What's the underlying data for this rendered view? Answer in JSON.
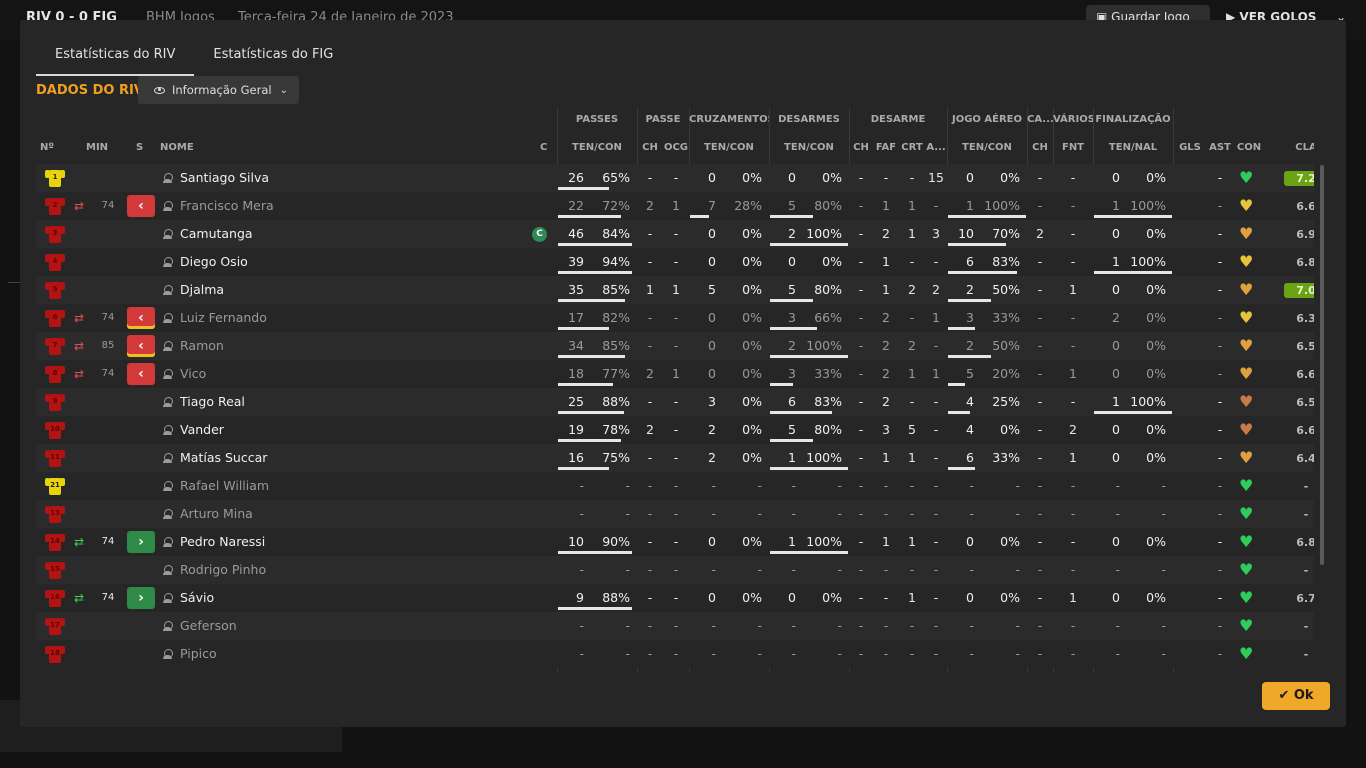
{
  "background": {
    "score": "RIV  0 - 0  FIG",
    "company": "BHM Jogos",
    "date": "Terça-feira 24 de Janeiro de 2023",
    "save_label": "Guardar Jogo",
    "goals_label": "VER GOLOS"
  },
  "tabs": [
    {
      "label": "Estatísticas do RIV",
      "active": true
    },
    {
      "label": "Estatísticas do FIG",
      "active": false
    }
  ],
  "section_title": "DADOS DO RIV",
  "view_dropdown": {
    "label": "Informação Geral"
  },
  "groups": {
    "passes": "PASSES",
    "passe": "PASSE",
    "cruzamentos": "CRUZAMENTOS",
    "desarmes": "DESARMES",
    "desarme": "DESARME",
    "jogo_aereo": "JOGO AÉREO",
    "ca": "CA...",
    "varios": "VÁRIOS",
    "finalizacao": "FINALIZAÇÃO"
  },
  "headers": {
    "no": "Nº",
    "min": "MIN",
    "s": "S",
    "nome": "NOME",
    "c": "C",
    "passes_tc": "TEN/CON",
    "passe_ch": "CH",
    "passe_ocg": "OCG",
    "cruz_tc": "TEN/CON",
    "des_tc": "TEN/CON",
    "desarme_ch": "CH",
    "desarme_faf": "FAF",
    "desarme_crt": "CRT",
    "desarme_a": "A...",
    "aereo_tc": "TEN/CON",
    "ca_ch": "CH",
    "varios_fnt": "FNT",
    "fin_tn": "TEN/NAL",
    "gls": "GLS",
    "ast": "AST",
    "con": "CON",
    "cla": "CLA"
  },
  "colors": {
    "accent": "#f0a020",
    "heart_green": "#2ecc5a",
    "heart_yellow": "#e8c43a",
    "heart_orange": "#e0a040",
    "heart_brown": "#c87a48",
    "rating_high": "#6aa313",
    "sub_out": "#d23a3a",
    "sub_in": "#2f8a48"
  },
  "players": [
    {
      "shirt": "gk",
      "number": "1",
      "name": "Santiago Silva",
      "on": true,
      "min": "",
      "sub": "",
      "captain": false,
      "p": [
        "26",
        "65%"
      ],
      "pb": 0.69,
      "pch": "-",
      "pocg": "-",
      "cr": [
        "0",
        "0%"
      ],
      "crb": 0,
      "de": [
        "0",
        "0%"
      ],
      "deb": 0,
      "dch": "-",
      "dfaf": "-",
      "dcrt": "-",
      "da": "15",
      "ja": [
        "0",
        "0%"
      ],
      "jab": 0,
      "cach": "-",
      "fnt": "-",
      "fi": [
        "0",
        "0%"
      ],
      "fib": 0,
      "gls": "",
      "ast": "-",
      "con": "green",
      "cla": "7.2",
      "hi": true
    },
    {
      "shirt": "out",
      "number": "2",
      "name": "Francisco Mera",
      "on": false,
      "min": "74",
      "sub": "out",
      "subYellow": false,
      "captain": false,
      "p": [
        "22",
        "72%"
      ],
      "pb": 0.85,
      "pch": "2",
      "pocg": "1",
      "cr": [
        "7",
        "28%"
      ],
      "crb": 0.25,
      "de": [
        "5",
        "80%"
      ],
      "deb": 0.55,
      "dch": "-",
      "dfaf": "1",
      "dcrt": "1",
      "da": "-",
      "ja": [
        "1",
        "100%"
      ],
      "jab": 1,
      "cach": "-",
      "fnt": "-",
      "fi": [
        "1",
        "100%"
      ],
      "fib": 1,
      "gls": "",
      "ast": "-",
      "con": "yellow",
      "cla": "6.6",
      "hi": false
    },
    {
      "shirt": "out",
      "number": "3",
      "name": "Camutanga",
      "on": true,
      "min": "",
      "sub": "",
      "captain": true,
      "p": [
        "46",
        "84%"
      ],
      "pb": 1,
      "pch": "-",
      "pocg": "-",
      "cr": [
        "0",
        "0%"
      ],
      "crb": 0,
      "de": [
        "2",
        "100%"
      ],
      "deb": 1,
      "dch": "-",
      "dfaf": "2",
      "dcrt": "1",
      "da": "3",
      "ja": [
        "10",
        "70%"
      ],
      "jab": 0.74,
      "cach": "2",
      "fnt": "-",
      "fi": [
        "0",
        "0%"
      ],
      "fib": 0,
      "gls": "",
      "ast": "-",
      "con": "orange",
      "cla": "6.9",
      "hi": false
    },
    {
      "shirt": "out",
      "number": "4",
      "name": "Diego Osio",
      "on": true,
      "min": "",
      "sub": "",
      "captain": false,
      "p": [
        "39",
        "94%"
      ],
      "pb": 1,
      "pch": "-",
      "pocg": "-",
      "cr": [
        "0",
        "0%"
      ],
      "crb": 0,
      "de": [
        "0",
        "0%"
      ],
      "deb": 0,
      "dch": "-",
      "dfaf": "1",
      "dcrt": "-",
      "da": "-",
      "ja": [
        "6",
        "83%"
      ],
      "jab": 0.88,
      "cach": "-",
      "fnt": "-",
      "fi": [
        "1",
        "100%"
      ],
      "fib": 1,
      "gls": "",
      "ast": "-",
      "con": "yellow",
      "cla": "6.8",
      "hi": false
    },
    {
      "shirt": "out",
      "number": "5",
      "name": "Djalma",
      "on": true,
      "min": "",
      "sub": "",
      "captain": false,
      "p": [
        "35",
        "85%"
      ],
      "pb": 0.9,
      "pch": "1",
      "pocg": "1",
      "cr": [
        "5",
        "0%"
      ],
      "crb": 0,
      "de": [
        "5",
        "80%"
      ],
      "deb": 0.55,
      "dch": "-",
      "dfaf": "1",
      "dcrt": "2",
      "da": "2",
      "ja": [
        "2",
        "50%"
      ],
      "jab": 0.55,
      "cach": "-",
      "fnt": "1",
      "fi": [
        "0",
        "0%"
      ],
      "fib": 0,
      "gls": "",
      "ast": "-",
      "con": "orange",
      "cla": "7.0",
      "hi": true
    },
    {
      "shirt": "out",
      "number": "6",
      "name": "Luiz Fernando",
      "on": false,
      "min": "74",
      "sub": "out",
      "subYellow": true,
      "captain": false,
      "p": [
        "17",
        "82%"
      ],
      "pb": 0.69,
      "pch": "-",
      "pocg": "-",
      "cr": [
        "0",
        "0%"
      ],
      "crb": 0,
      "de": [
        "3",
        "66%"
      ],
      "deb": 0.6,
      "dch": "-",
      "dfaf": "2",
      "dcrt": "-",
      "da": "1",
      "ja": [
        "3",
        "33%"
      ],
      "jab": 0.34,
      "cach": "-",
      "fnt": "-",
      "fi": [
        "2",
        "0%"
      ],
      "fib": 0,
      "gls": "",
      "ast": "-",
      "con": "yellow",
      "cla": "6.3",
      "hi": false
    },
    {
      "shirt": "out",
      "number": "7",
      "name": "Ramon",
      "on": false,
      "min": "85",
      "sub": "out",
      "subYellow": true,
      "captain": false,
      "p": [
        "34",
        "85%"
      ],
      "pb": 0.9,
      "pch": "-",
      "pocg": "-",
      "cr": [
        "0",
        "0%"
      ],
      "crb": 0,
      "de": [
        "2",
        "100%"
      ],
      "deb": 1,
      "dch": "-",
      "dfaf": "2",
      "dcrt": "2",
      "da": "-",
      "ja": [
        "2",
        "50%"
      ],
      "jab": 0.55,
      "cach": "-",
      "fnt": "-",
      "fi": [
        "0",
        "0%"
      ],
      "fib": 0,
      "gls": "",
      "ast": "-",
      "con": "orange",
      "cla": "6.5",
      "hi": false
    },
    {
      "shirt": "out",
      "number": "8",
      "name": "Vico",
      "on": false,
      "min": "74",
      "sub": "out",
      "subYellow": false,
      "captain": false,
      "p": [
        "18",
        "77%"
      ],
      "pb": 0.74,
      "pch": "2",
      "pocg": "1",
      "cr": [
        "0",
        "0%"
      ],
      "crb": 0,
      "de": [
        "3",
        "33%"
      ],
      "deb": 0.3,
      "dch": "-",
      "dfaf": "2",
      "dcrt": "1",
      "da": "1",
      "ja": [
        "5",
        "20%"
      ],
      "jab": 0.22,
      "cach": "-",
      "fnt": "1",
      "fi": [
        "0",
        "0%"
      ],
      "fib": 0,
      "gls": "",
      "ast": "-",
      "con": "orange",
      "cla": "6.6",
      "hi": false
    },
    {
      "shirt": "out",
      "number": "9",
      "name": "Tiago Real",
      "on": true,
      "min": "",
      "sub": "",
      "captain": false,
      "p": [
        "25",
        "88%"
      ],
      "pb": 0.89,
      "pch": "-",
      "pocg": "-",
      "cr": [
        "3",
        "0%"
      ],
      "crb": 0,
      "de": [
        "6",
        "83%"
      ],
      "deb": 0.8,
      "dch": "-",
      "dfaf": "2",
      "dcrt": "-",
      "da": "-",
      "ja": [
        "4",
        "25%"
      ],
      "jab": 0.28,
      "cach": "-",
      "fnt": "-",
      "fi": [
        "1",
        "100%"
      ],
      "fib": 1,
      "gls": "",
      "ast": "-",
      "con": "brown",
      "cla": "6.5",
      "hi": false
    },
    {
      "shirt": "out",
      "number": "10",
      "name": "Vander",
      "on": true,
      "min": "",
      "sub": "",
      "captain": false,
      "p": [
        "19",
        "78%"
      ],
      "pb": 0.85,
      "pch": "2",
      "pocg": "-",
      "cr": [
        "2",
        "0%"
      ],
      "crb": 0,
      "de": [
        "5",
        "80%"
      ],
      "deb": 0.55,
      "dch": "-",
      "dfaf": "3",
      "dcrt": "5",
      "da": "-",
      "ja": [
        "4",
        "0%"
      ],
      "jab": 0,
      "cach": "-",
      "fnt": "2",
      "fi": [
        "0",
        "0%"
      ],
      "fib": 0,
      "gls": "",
      "ast": "-",
      "con": "brown",
      "cla": "6.6",
      "hi": false
    },
    {
      "shirt": "out",
      "number": "11",
      "name": "Matías Succar",
      "on": true,
      "min": "",
      "sub": "",
      "captain": false,
      "p": [
        "16",
        "75%"
      ],
      "pb": 0.69,
      "pch": "-",
      "pocg": "-",
      "cr": [
        "2",
        "0%"
      ],
      "crb": 0,
      "de": [
        "1",
        "100%"
      ],
      "deb": 1,
      "dch": "-",
      "dfaf": "1",
      "dcrt": "1",
      "da": "-",
      "ja": [
        "6",
        "33%"
      ],
      "jab": 0.34,
      "cach": "-",
      "fnt": "1",
      "fi": [
        "0",
        "0%"
      ],
      "fib": 0,
      "gls": "",
      "ast": "-",
      "con": "orange",
      "cla": "6.4",
      "hi": false
    },
    {
      "shirt": "gk",
      "number": "21",
      "name": "Rafael William",
      "on": false,
      "min": "",
      "sub": "",
      "captain": false,
      "p": [
        "-",
        "-"
      ],
      "pb": 0,
      "pch": "-",
      "pocg": "-",
      "cr": [
        "-",
        "-"
      ],
      "crb": 0,
      "de": [
        "-",
        "-"
      ],
      "deb": 0,
      "dch": "-",
      "dfaf": "-",
      "dcrt": "-",
      "da": "-",
      "ja": [
        "-",
        "-"
      ],
      "jab": 0,
      "cach": "-",
      "fnt": "-",
      "fi": [
        "-",
        "-"
      ],
      "fib": 0,
      "gls": "",
      "ast": "-",
      "con": "green",
      "cla": "-",
      "hi": false
    },
    {
      "shirt": "out",
      "number": "13",
      "name": "Arturo Mina",
      "on": false,
      "min": "",
      "sub": "",
      "captain": false,
      "p": [
        "-",
        "-"
      ],
      "pb": 0,
      "pch": "-",
      "pocg": "-",
      "cr": [
        "-",
        "-"
      ],
      "crb": 0,
      "de": [
        "-",
        "-"
      ],
      "deb": 0,
      "dch": "-",
      "dfaf": "-",
      "dcrt": "-",
      "da": "-",
      "ja": [
        "-",
        "-"
      ],
      "jab": 0,
      "cach": "-",
      "fnt": "-",
      "fi": [
        "-",
        "-"
      ],
      "fib": 0,
      "gls": "",
      "ast": "-",
      "con": "green",
      "cla": "-",
      "hi": false
    },
    {
      "shirt": "out",
      "number": "14",
      "name": "Pedro Naressi",
      "on": true,
      "min": "74",
      "sub": "in",
      "captain": false,
      "p": [
        "10",
        "90%"
      ],
      "pb": 1,
      "pch": "-",
      "pocg": "-",
      "cr": [
        "0",
        "0%"
      ],
      "crb": 0,
      "de": [
        "1",
        "100%"
      ],
      "deb": 1,
      "dch": "-",
      "dfaf": "1",
      "dcrt": "1",
      "da": "-",
      "ja": [
        "0",
        "0%"
      ],
      "jab": 0,
      "cach": "-",
      "fnt": "-",
      "fi": [
        "0",
        "0%"
      ],
      "fib": 0,
      "gls": "",
      "ast": "-",
      "con": "green",
      "cla": "6.8",
      "hi": false
    },
    {
      "shirt": "out",
      "number": "15",
      "name": "Rodrigo Pinho",
      "on": false,
      "min": "",
      "sub": "",
      "captain": false,
      "p": [
        "-",
        "-"
      ],
      "pb": 0,
      "pch": "-",
      "pocg": "-",
      "cr": [
        "-",
        "-"
      ],
      "crb": 0,
      "de": [
        "-",
        "-"
      ],
      "deb": 0,
      "dch": "-",
      "dfaf": "-",
      "dcrt": "-",
      "da": "-",
      "ja": [
        "-",
        "-"
      ],
      "jab": 0,
      "cach": "-",
      "fnt": "-",
      "fi": [
        "-",
        "-"
      ],
      "fib": 0,
      "gls": "",
      "ast": "-",
      "con": "green",
      "cla": "-",
      "hi": false
    },
    {
      "shirt": "out",
      "number": "16",
      "name": "Sávio",
      "on": true,
      "min": "74",
      "sub": "in",
      "captain": false,
      "p": [
        "9",
        "88%"
      ],
      "pb": 1,
      "pch": "-",
      "pocg": "-",
      "cr": [
        "0",
        "0%"
      ],
      "crb": 0,
      "de": [
        "0",
        "0%"
      ],
      "deb": 0,
      "dch": "-",
      "dfaf": "-",
      "dcrt": "1",
      "da": "-",
      "ja": [
        "0",
        "0%"
      ],
      "jab": 0,
      "cach": "-",
      "fnt": "1",
      "fi": [
        "0",
        "0%"
      ],
      "fib": 0,
      "gls": "",
      "ast": "-",
      "con": "green",
      "cla": "6.7",
      "hi": false
    },
    {
      "shirt": "out",
      "number": "17",
      "name": "Geferson",
      "on": false,
      "min": "",
      "sub": "",
      "captain": false,
      "p": [
        "-",
        "-"
      ],
      "pb": 0,
      "pch": "-",
      "pocg": "-",
      "cr": [
        "-",
        "-"
      ],
      "crb": 0,
      "de": [
        "-",
        "-"
      ],
      "deb": 0,
      "dch": "-",
      "dfaf": "-",
      "dcrt": "-",
      "da": "-",
      "ja": [
        "-",
        "-"
      ],
      "jab": 0,
      "cach": "-",
      "fnt": "-",
      "fi": [
        "-",
        "-"
      ],
      "fib": 0,
      "gls": "",
      "ast": "-",
      "con": "green",
      "cla": "-",
      "hi": false
    },
    {
      "shirt": "out",
      "number": "18",
      "name": "Pipico",
      "on": false,
      "min": "",
      "sub": "",
      "captain": false,
      "p": [
        "-",
        "-"
      ],
      "pb": 0,
      "pch": "-",
      "pocg": "-",
      "cr": [
        "-",
        "-"
      ],
      "crb": 0,
      "de": [
        "-",
        "-"
      ],
      "deb": 0,
      "dch": "-",
      "dfaf": "-",
      "dcrt": "-",
      "da": "-",
      "ja": [
        "-",
        "-"
      ],
      "jab": 0,
      "cach": "-",
      "fnt": "-",
      "fi": [
        "-",
        "-"
      ],
      "fib": 0,
      "gls": "",
      "ast": "-",
      "con": "green",
      "cla": "-",
      "hi": false
    }
  ],
  "ok_label": "Ok"
}
